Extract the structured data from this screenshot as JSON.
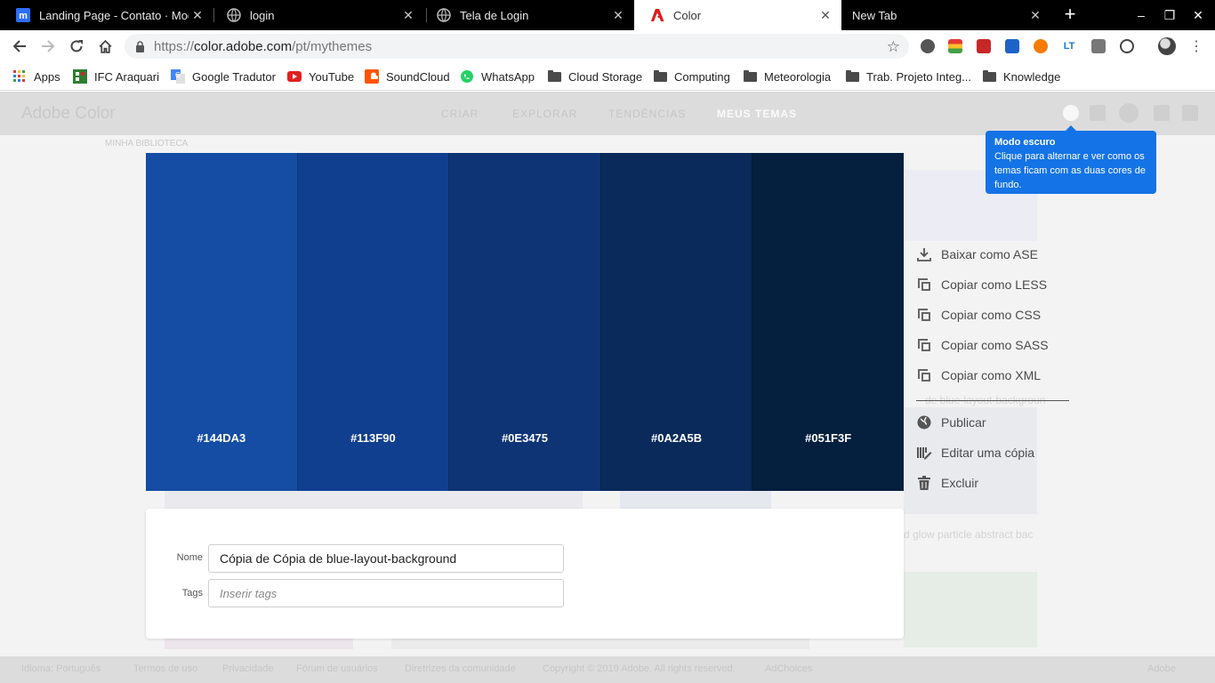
{
  "browser": {
    "tabs": [
      {
        "title": "Landing Page - Contato · Moqups",
        "icon": "moqups-icon",
        "active": false
      },
      {
        "title": "login",
        "icon": "globe-icon",
        "active": false
      },
      {
        "title": "Tela de Login",
        "icon": "globe-icon",
        "active": false
      },
      {
        "title": "Color",
        "icon": "adobe-icon",
        "active": true
      },
      {
        "title": "New Tab",
        "icon": "",
        "active": false
      }
    ],
    "new_tab_symbol": "+",
    "window_controls": {
      "minimize": "–",
      "restore": "❐",
      "close": "✕"
    },
    "url": {
      "scheme": "https://",
      "host": "color.adobe.com",
      "path": "/pt/mythemes"
    },
    "bookmarks": [
      {
        "label": "Apps",
        "icon": "apps-grid-icon"
      },
      {
        "label": "IFC Araquari",
        "icon": "ifc-icon"
      },
      {
        "label": "Google Tradutor",
        "icon": "translate-icon"
      },
      {
        "label": "YouTube",
        "icon": "youtube-icon"
      },
      {
        "label": "SoundCloud",
        "icon": "soundcloud-icon"
      },
      {
        "label": "WhatsApp",
        "icon": "whatsapp-icon"
      },
      {
        "label": "Cloud Storage",
        "icon": "folder-icon"
      },
      {
        "label": "Computing",
        "icon": "folder-icon"
      },
      {
        "label": "Meteorologia",
        "icon": "folder-icon"
      },
      {
        "label": "Trab. Projeto Integ...",
        "icon": "folder-icon"
      },
      {
        "label": "Knowledge",
        "icon": "folder-icon"
      }
    ]
  },
  "site": {
    "logo": "Adobe Color",
    "nav": [
      "CRIAR",
      "EXPLORAR",
      "TENDÊNCIAS",
      "MEUS TEMAS"
    ],
    "current_nav": "MEUS TEMAS",
    "breadcrumb": "MINHA BIBLIOTECA",
    "footer": [
      "Idioma: Português",
      "Termos de uso",
      "Privacidade",
      "Fórum de usuários",
      "Diretrizes da comunidade",
      "Copyright © 2019 Adobe. All rights reserved.",
      "AdChoices",
      "Adobe"
    ],
    "background_snippets": [
      "de blue-layout-backgroun",
      "d glow particle abstract bac"
    ]
  },
  "theme": {
    "swatches": [
      {
        "hex": "#144DA3",
        "color": "#144DA3"
      },
      {
        "hex": "#113F90",
        "color": "#113F90"
      },
      {
        "hex": "#0E3475",
        "color": "#0E3475"
      },
      {
        "hex": "#0A2A5B",
        "color": "#0A2A5B"
      },
      {
        "hex": "#051F3F",
        "color": "#051F3F"
      }
    ],
    "form": {
      "name_label": "Nome",
      "name_value": "Cópia de Cópia de blue-layout-background",
      "tags_label": "Tags",
      "tags_placeholder": "Inserir tags"
    }
  },
  "actions": {
    "download_ase": "Baixar como ASE",
    "copy_less": "Copiar como LESS",
    "copy_css": "Copiar como CSS",
    "copy_sass": "Copiar como SASS",
    "copy_xml": "Copiar como XML",
    "publish": "Publicar",
    "edit_copy": "Editar uma cópia",
    "delete": "Excluir"
  },
  "tooltip": {
    "title": "Modo escuro",
    "body": "Clique para alternar e ver como os temas ficam com as duas cores de fundo."
  },
  "colors": {
    "tooltip_bg": "#1473E6",
    "tabstrip_bg": "#000000"
  }
}
